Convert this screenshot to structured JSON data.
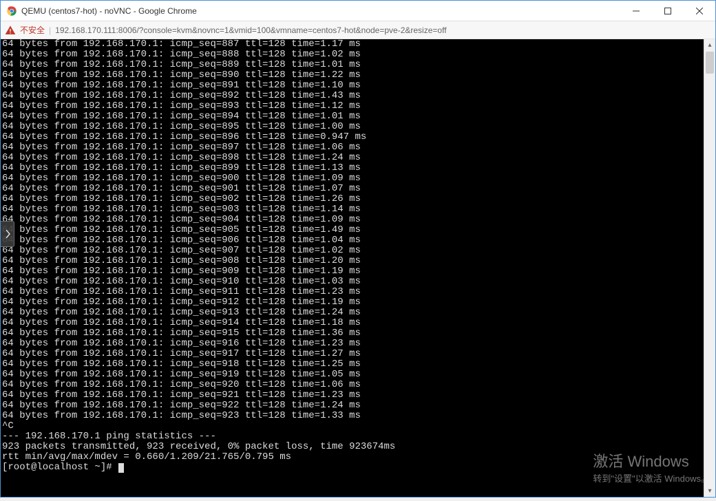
{
  "window": {
    "title": "QEMU (centos7-hot) - noVNC - Google Chrome"
  },
  "addressbar": {
    "insecure_label": "不安全",
    "url": "192.168.170.111:8006/?console=kvm&novnc=1&vmid=100&vmname=centos7-hot&node=pve-2&resize=off"
  },
  "ping": {
    "host": "192.168.170.1",
    "bytes": 64,
    "ttl": 128,
    "lines": [
      {
        "seq": 887,
        "time": "1.17",
        "partial": true
      },
      {
        "seq": 888,
        "time": "1.02"
      },
      {
        "seq": 889,
        "time": "1.01"
      },
      {
        "seq": 890,
        "time": "1.22"
      },
      {
        "seq": 891,
        "time": "1.10"
      },
      {
        "seq": 892,
        "time": "1.43"
      },
      {
        "seq": 893,
        "time": "1.12"
      },
      {
        "seq": 894,
        "time": "1.01"
      },
      {
        "seq": 895,
        "time": "1.00"
      },
      {
        "seq": 896,
        "time": "0.947"
      },
      {
        "seq": 897,
        "time": "1.06"
      },
      {
        "seq": 898,
        "time": "1.24"
      },
      {
        "seq": 899,
        "time": "1.13"
      },
      {
        "seq": 900,
        "time": "1.09"
      },
      {
        "seq": 901,
        "time": "1.07"
      },
      {
        "seq": 902,
        "time": "1.26"
      },
      {
        "seq": 903,
        "time": "1.14"
      },
      {
        "seq": 904,
        "time": "1.09"
      },
      {
        "seq": 905,
        "time": "1.49"
      },
      {
        "seq": 906,
        "time": "1.04"
      },
      {
        "seq": 907,
        "time": "1.02"
      },
      {
        "seq": 908,
        "time": "1.20"
      },
      {
        "seq": 909,
        "time": "1.19"
      },
      {
        "seq": 910,
        "time": "1.03"
      },
      {
        "seq": 911,
        "time": "1.23"
      },
      {
        "seq": 912,
        "time": "1.19"
      },
      {
        "seq": 913,
        "time": "1.24"
      },
      {
        "seq": 914,
        "time": "1.18"
      },
      {
        "seq": 915,
        "time": "1.36"
      },
      {
        "seq": 916,
        "time": "1.23"
      },
      {
        "seq": 917,
        "time": "1.27"
      },
      {
        "seq": 918,
        "time": "1.25"
      },
      {
        "seq": 919,
        "time": "1.05"
      },
      {
        "seq": 920,
        "time": "1.06"
      },
      {
        "seq": 921,
        "time": "1.23"
      },
      {
        "seq": 922,
        "time": "1.24"
      },
      {
        "seq": 923,
        "time": "1.33"
      }
    ],
    "interrupt": "^C",
    "stats_header": "--- 192.168.170.1 ping statistics ---",
    "stats_summary": "923 packets transmitted, 923 received, 0% packet loss, time 923674ms",
    "stats_rtt": "rtt min/avg/max/mdev = 0.660/1.209/21.765/0.795 ms",
    "prompt": "[root@localhost ~]#"
  },
  "watermark": {
    "line1": "激活 Windows",
    "line2": "转到\"设置\"以激活 Windows。"
  }
}
